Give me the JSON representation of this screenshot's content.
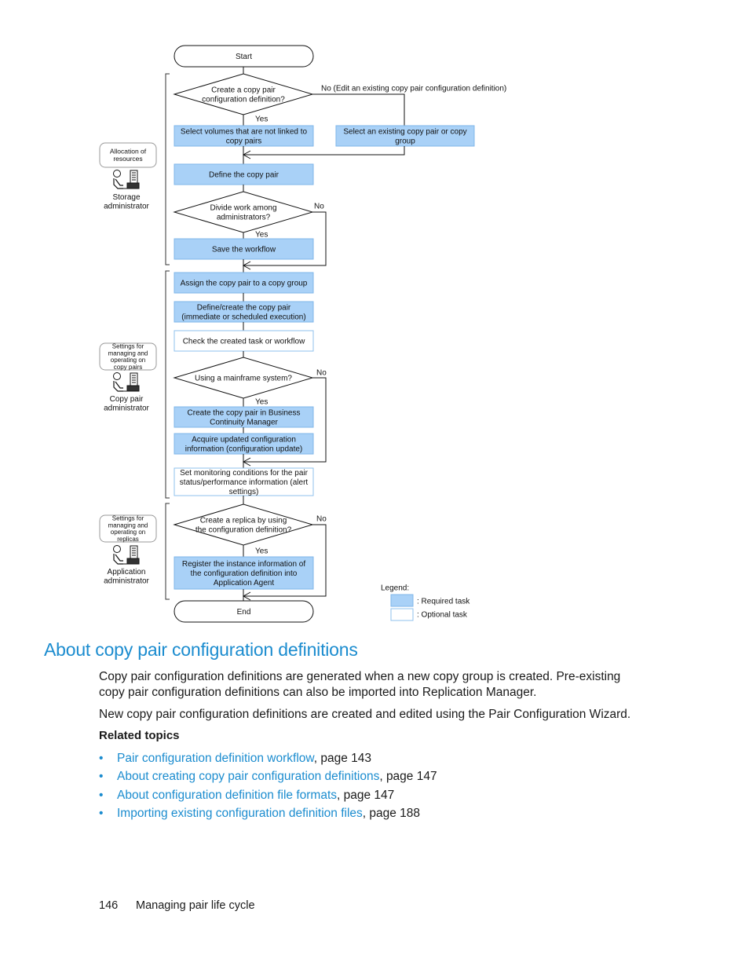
{
  "diagram": {
    "colors": {
      "required_fill": "#a9d1f7",
      "required_stroke": "#7fb6ea",
      "optional_fill": "#ffffff",
      "optional_stroke": "#8fc0ee",
      "line": "#111111"
    },
    "start": "Start",
    "end": "End",
    "decision1": {
      "lines": [
        "Create a copy pair",
        "configuration definition?"
      ],
      "yes": "Yes",
      "no": "No (Edit an existing copy pair configuration definition)"
    },
    "task_select_volumes": [
      "Select volumes that are not linked to",
      "copy pairs"
    ],
    "task_select_existing": [
      "Select an existing copy pair or copy",
      "group"
    ],
    "task_define_pair": [
      "Define the copy pair"
    ],
    "decision2": {
      "lines": [
        "Divide work among",
        "administrators?"
      ],
      "yes": "Yes",
      "no": "No"
    },
    "task_save_workflow": [
      "Save the workflow"
    ],
    "task_assign_group": [
      "Assign the copy pair to a copy group"
    ],
    "task_define_create": [
      "Define/create the copy pair",
      "(immediate or scheduled execution)"
    ],
    "task_check_task": [
      "Check the created task or workflow"
    ],
    "decision3": {
      "lines": [
        "Using a mainframe system?"
      ],
      "yes": "Yes",
      "no": "No"
    },
    "task_create_bcm": [
      "Create the copy pair in Business",
      "Continuity Manager"
    ],
    "task_acquire_config": [
      "Acquire updated configuration",
      "information (configuration update)"
    ],
    "task_set_monitoring": [
      "Set monitoring conditions for the pair",
      "status/performance information (alert",
      "settings)"
    ],
    "decision4": {
      "lines": [
        "Create a replica by using",
        "the configuration definition?"
      ],
      "yes": "Yes",
      "no": "No"
    },
    "task_register_instance": [
      "Register the instance information of",
      "the configuration definition into",
      "Application Agent"
    ],
    "roles": [
      {
        "phase": [
          "Allocation of",
          "resources"
        ],
        "name": [
          "Storage",
          "administrator"
        ]
      },
      {
        "phase": [
          "Settings for",
          "managing and",
          "operating on",
          "copy pairs"
        ],
        "name": [
          "Copy pair",
          "administrator"
        ]
      },
      {
        "phase": [
          "Settings for",
          "managing and",
          "operating on",
          "replicas"
        ],
        "name": [
          "Application",
          "administrator"
        ]
      }
    ],
    "legend": {
      "title": "Legend:",
      "required": ": Required task",
      "optional": ": Optional task"
    }
  },
  "section": {
    "title": "About copy pair configuration definitions",
    "paragraph1": "Copy pair configuration definitions are generated when a new copy group is created. Pre-existing copy pair configuration definitions can also be imported into Replication Manager.",
    "paragraph2": "New copy pair configuration definitions are created and edited using the Pair Configuration Wizard.",
    "related_heading": "Related topics",
    "related_topics": [
      {
        "link": "Pair configuration definition workflow",
        "suffix": ", page 143"
      },
      {
        "link": "About creating copy pair configuration definitions",
        "suffix": ", page 147"
      },
      {
        "link": "About configuration definition file formats",
        "suffix": ", page 147"
      },
      {
        "link": "Importing existing configuration definition files",
        "suffix": ", page 188"
      }
    ],
    "link_color": "#1b8ccf"
  },
  "footer": {
    "page_number": "146",
    "chapter": "Managing pair life cycle"
  }
}
